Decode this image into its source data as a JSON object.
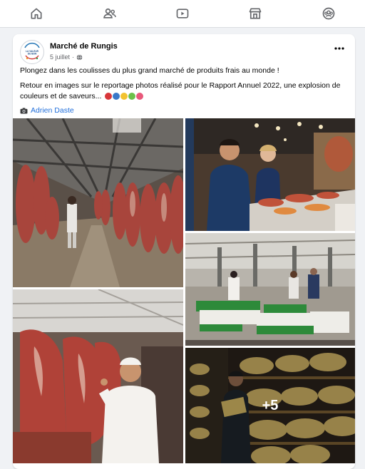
{
  "nav": {
    "items": [
      {
        "icon": "home-icon"
      },
      {
        "icon": "friends-icon"
      },
      {
        "icon": "video-icon"
      },
      {
        "icon": "marketplace-icon"
      },
      {
        "icon": "groups-icon"
      }
    ]
  },
  "post": {
    "page_name": "Marché de Rungis",
    "date": "5 juillet",
    "separator": "·",
    "logo_text": {
      "line1": "LA VALEUR",
      "line2": "DU BON"
    },
    "text_line1": "Plongez dans les coulisses du plus grand marché de produits frais au monde !",
    "text_line2": "Retour en images sur le reportage photos réalisé pour le Rapport Annuel 2022, une explosion de couleurs et de saveurs...",
    "credit": "Adrien Daste",
    "more_photos": "+5",
    "colors": {
      "link": "#216fdb",
      "muted": "#65676b",
      "nav_icon": "#65676b"
    }
  }
}
